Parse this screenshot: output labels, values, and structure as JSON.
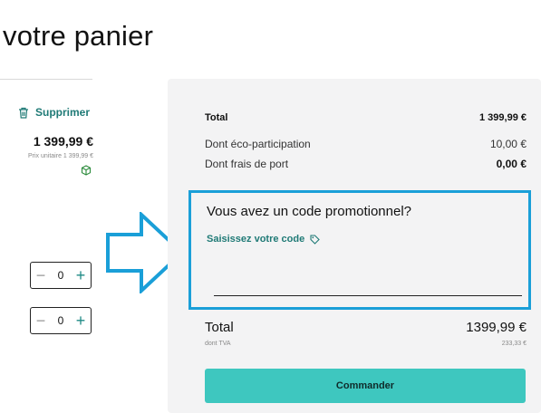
{
  "page": {
    "title": "votre panier"
  },
  "product": {
    "delete_label": "Supprimer",
    "price": "1 399,99 €",
    "unit_price": "Prix unitaire 1 399,99 €"
  },
  "steppers": [
    {
      "minus": "−",
      "value": "0",
      "plus": "+"
    },
    {
      "minus": "−",
      "value": "0",
      "plus": "+"
    }
  ],
  "summary": {
    "total_label": "Total",
    "total_value": "1 399,99 €",
    "eco_label": "Dont éco-participation",
    "eco_value": "10,00 €",
    "shipping_label": "Dont frais de port",
    "shipping_value": "0,00 €",
    "promo_title": "Vous avez un code promotionnel?",
    "promo_link": "Saisissez votre code",
    "promo_placeholder": "",
    "grand_total_label": "Total",
    "grand_total_value": "1399,99 €",
    "tva_label": "dont TVA",
    "tva_value": "233,33 €",
    "order_button": "Commander"
  },
  "colors": {
    "accent": "#1f7a76",
    "button": "#3ec7bf",
    "highlight": "#1a9fd8",
    "panel_bg": "#f3f3f4"
  },
  "icons": [
    "trash-icon",
    "box-icon",
    "tag-icon",
    "arrow-right-icon"
  ]
}
